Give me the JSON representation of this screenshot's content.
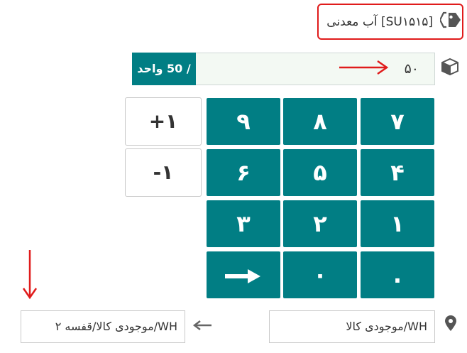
{
  "product": {
    "label": "[SU۱۵۱۵] آب معدنی"
  },
  "quantity": {
    "value": "۵۰",
    "unit_label": "/ 50 واحد"
  },
  "keypad": {
    "rows": [
      [
        "۹",
        "۸",
        "۷"
      ],
      [
        "۶",
        "۵",
        "۴"
      ],
      [
        "۳",
        "۲",
        "۱"
      ],
      [
        "",
        "۰",
        "."
      ]
    ],
    "increment": "+۱",
    "decrement": "-۱"
  },
  "location": {
    "source": "WH/موجودی کالا",
    "destination": "WH/موجودی کالا/قفسه ۲"
  },
  "colors": {
    "accent": "#017e84",
    "highlight_red": "#e01b1b",
    "field_bg": "#f3f9f3"
  },
  "icons": {
    "product": "tag-icon",
    "quantity": "cube-icon",
    "location": "map-pin-icon",
    "confirm": "arrow-right-icon",
    "transfer": "arrow-left-icon"
  }
}
